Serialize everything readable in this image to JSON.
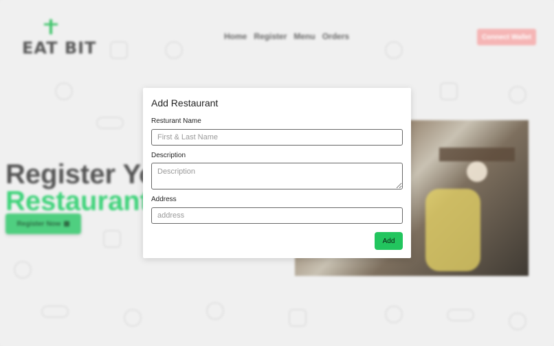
{
  "brand": {
    "logo_text": "EAT BIT"
  },
  "nav": {
    "items": [
      {
        "label": "Home"
      },
      {
        "label": "Register"
      },
      {
        "label": "Menu"
      },
      {
        "label": "Orders"
      }
    ],
    "connect_label": "Connect Wallet"
  },
  "hero": {
    "line1": "Register Your",
    "line2": "Restaurant",
    "cta_label": "Register Now"
  },
  "modal": {
    "title": "Add Restaurant",
    "name_label": "Resturant Name",
    "name_placeholder": "First & Last Name",
    "description_label": "Description",
    "description_placeholder": "Description",
    "address_label": "Address",
    "address_placeholder": "address",
    "add_label": "Add"
  },
  "colors": {
    "accent": "#22c55e",
    "connect_button": "#f5b5b5"
  }
}
